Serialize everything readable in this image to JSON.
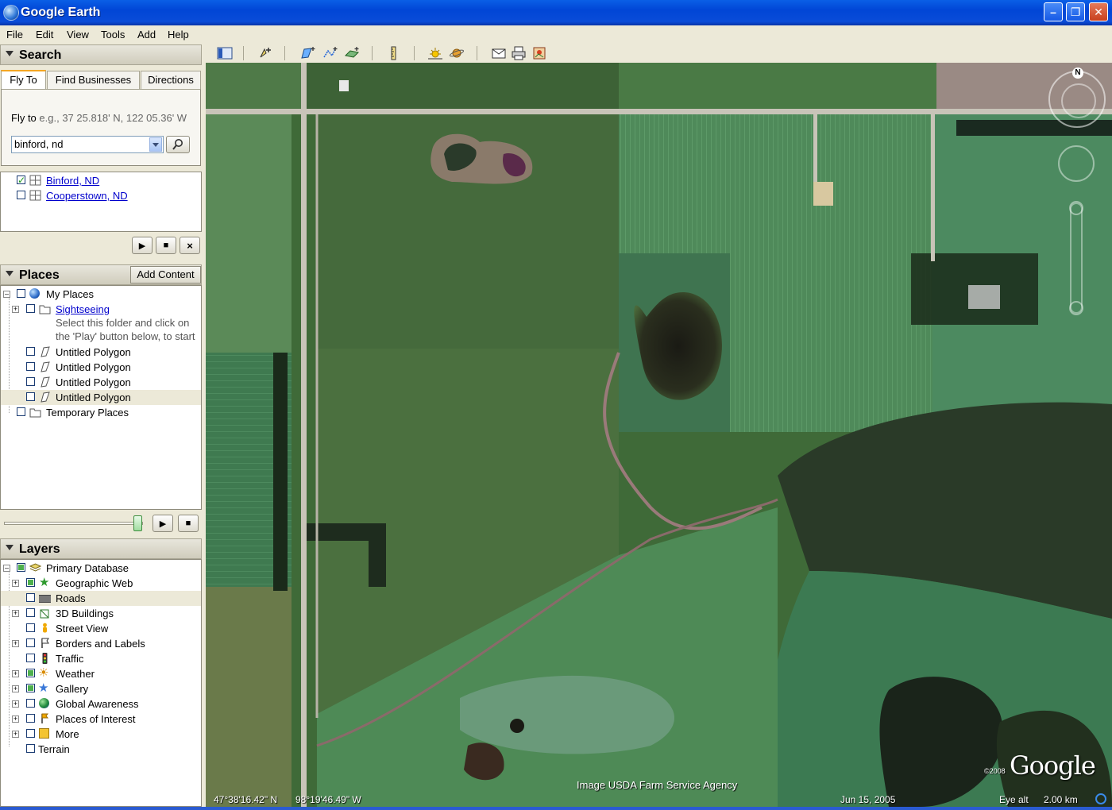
{
  "window": {
    "title": "Google Earth"
  },
  "menu": [
    "File",
    "Edit",
    "View",
    "Tools",
    "Add",
    "Help"
  ],
  "search": {
    "header": "Search",
    "tabs": [
      "Fly To",
      "Find Businesses",
      "Directions"
    ],
    "fly_to_label": "Fly to",
    "fly_to_example": "e.g., 37 25.818' N, 122 05.36' W",
    "input_value": "binford, nd",
    "results": [
      {
        "label": "Binford, ND",
        "checked": true
      },
      {
        "label": "Cooperstown, ND",
        "checked": false
      }
    ]
  },
  "places": {
    "header": "Places",
    "add_content": "Add Content",
    "items": {
      "my_places": "My Places",
      "sightseeing": "Sightseeing",
      "sightseeing_note_1": "Select this folder and click on",
      "sightseeing_note_2": "the 'Play' button below, to start",
      "polygon_1": "Untitled Polygon",
      "polygon_2": "Untitled Polygon",
      "polygon_3": "Untitled Polygon",
      "polygon_4": "Untitled Polygon",
      "temporary": "Temporary Places"
    }
  },
  "layers": {
    "header": "Layers",
    "items": {
      "primary": "Primary Database",
      "geographic_web": "Geographic Web",
      "roads": "Roads",
      "buildings": "3D Buildings",
      "street_view": "Street View",
      "borders": "Borders and Labels",
      "traffic": "Traffic",
      "weather": "Weather",
      "gallery": "Gallery",
      "global_awareness": "Global Awareness",
      "poi": "Places of Interest",
      "more": "More",
      "terrain": "Terrain"
    }
  },
  "map": {
    "compass_label": "N",
    "credit": "Image USDA Farm Service Agency",
    "copyright_year": "©2008",
    "logo": "Google",
    "latitude": "47°38'16.42\" N",
    "longitude": "98°19'46.49\" W",
    "date": "Jun 15, 2005",
    "eye_alt_label": "Eye alt",
    "eye_alt_value": "2.00 km"
  },
  "colors": {
    "titlebar": "#0146d6",
    "link": "#0000cc",
    "accent_tab": "#f5a623"
  }
}
